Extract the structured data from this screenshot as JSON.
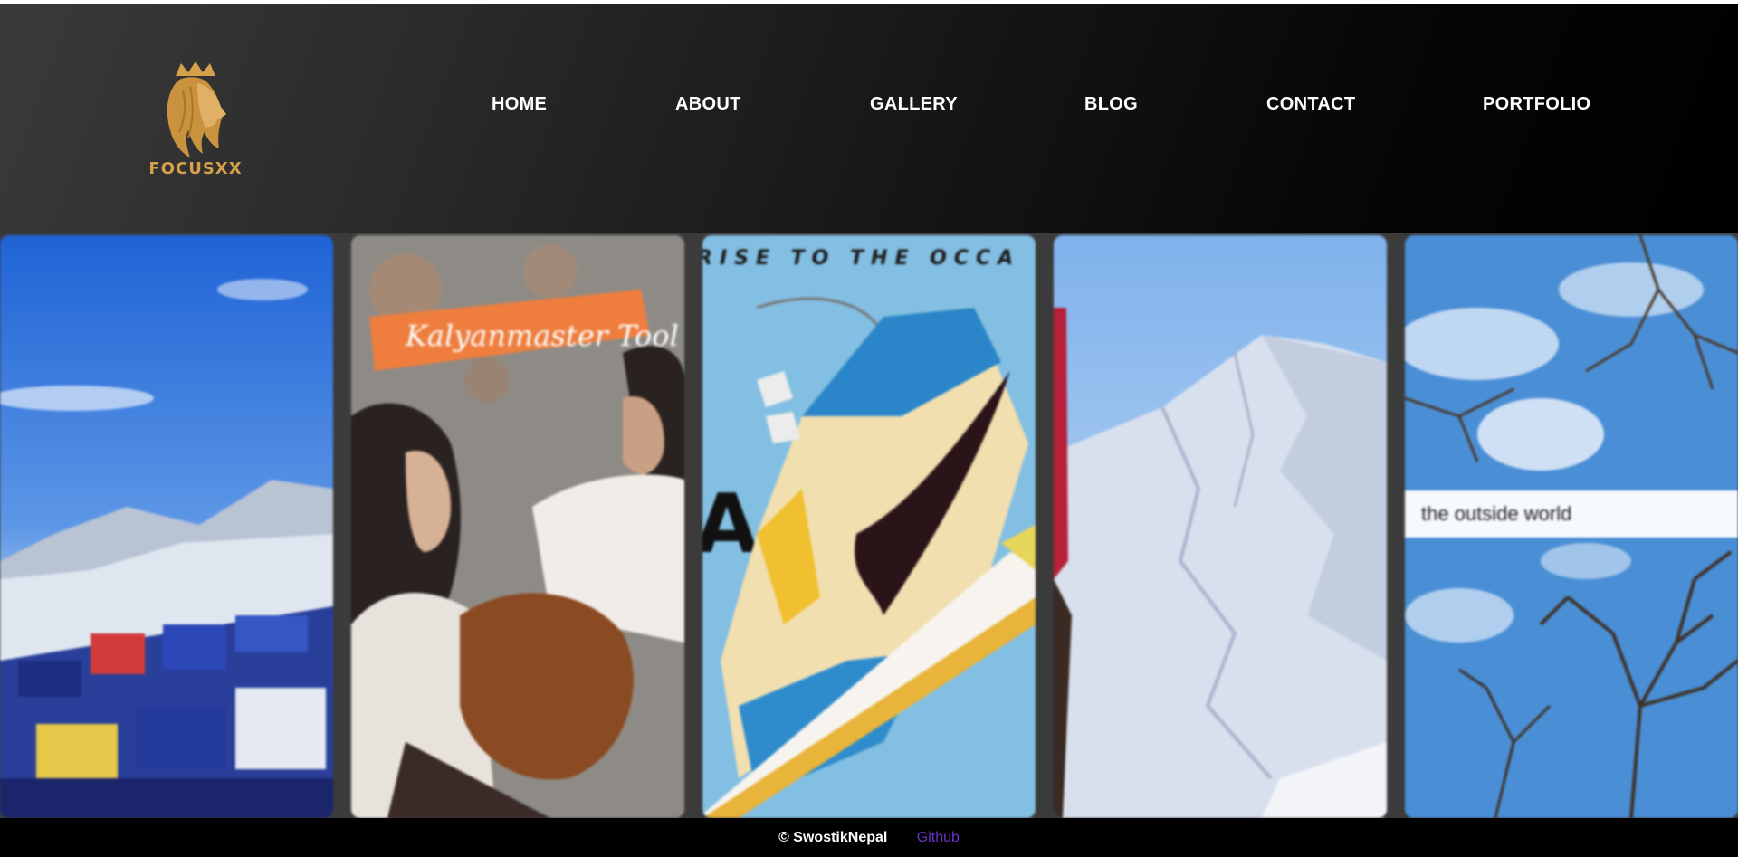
{
  "brand": {
    "name": "FOCUSXX",
    "color": "#d4a04a"
  },
  "nav": [
    {
      "label": "HOME"
    },
    {
      "label": "ABOUT"
    },
    {
      "label": "GALLERY"
    },
    {
      "label": "BLOG"
    },
    {
      "label": "CONTACT"
    },
    {
      "label": "PORTFOLIO"
    }
  ],
  "gallery": {
    "cards": [
      {
        "subject": "snowy-mountain-village"
      },
      {
        "subject": "couple-with-guitar",
        "overlay_text": "Kalyanmaster Tool"
      },
      {
        "subject": "sneaker-ad",
        "overlay_text": "RISE TO THE OCCA",
        "side_text": "A"
      },
      {
        "subject": "snow-mountain"
      },
      {
        "subject": "trees-and-sky",
        "caption": "the outside world"
      }
    ]
  },
  "footer": {
    "copyright": "© SwostikNepal",
    "link_label": "Github",
    "link_color": "#6a32c9"
  }
}
